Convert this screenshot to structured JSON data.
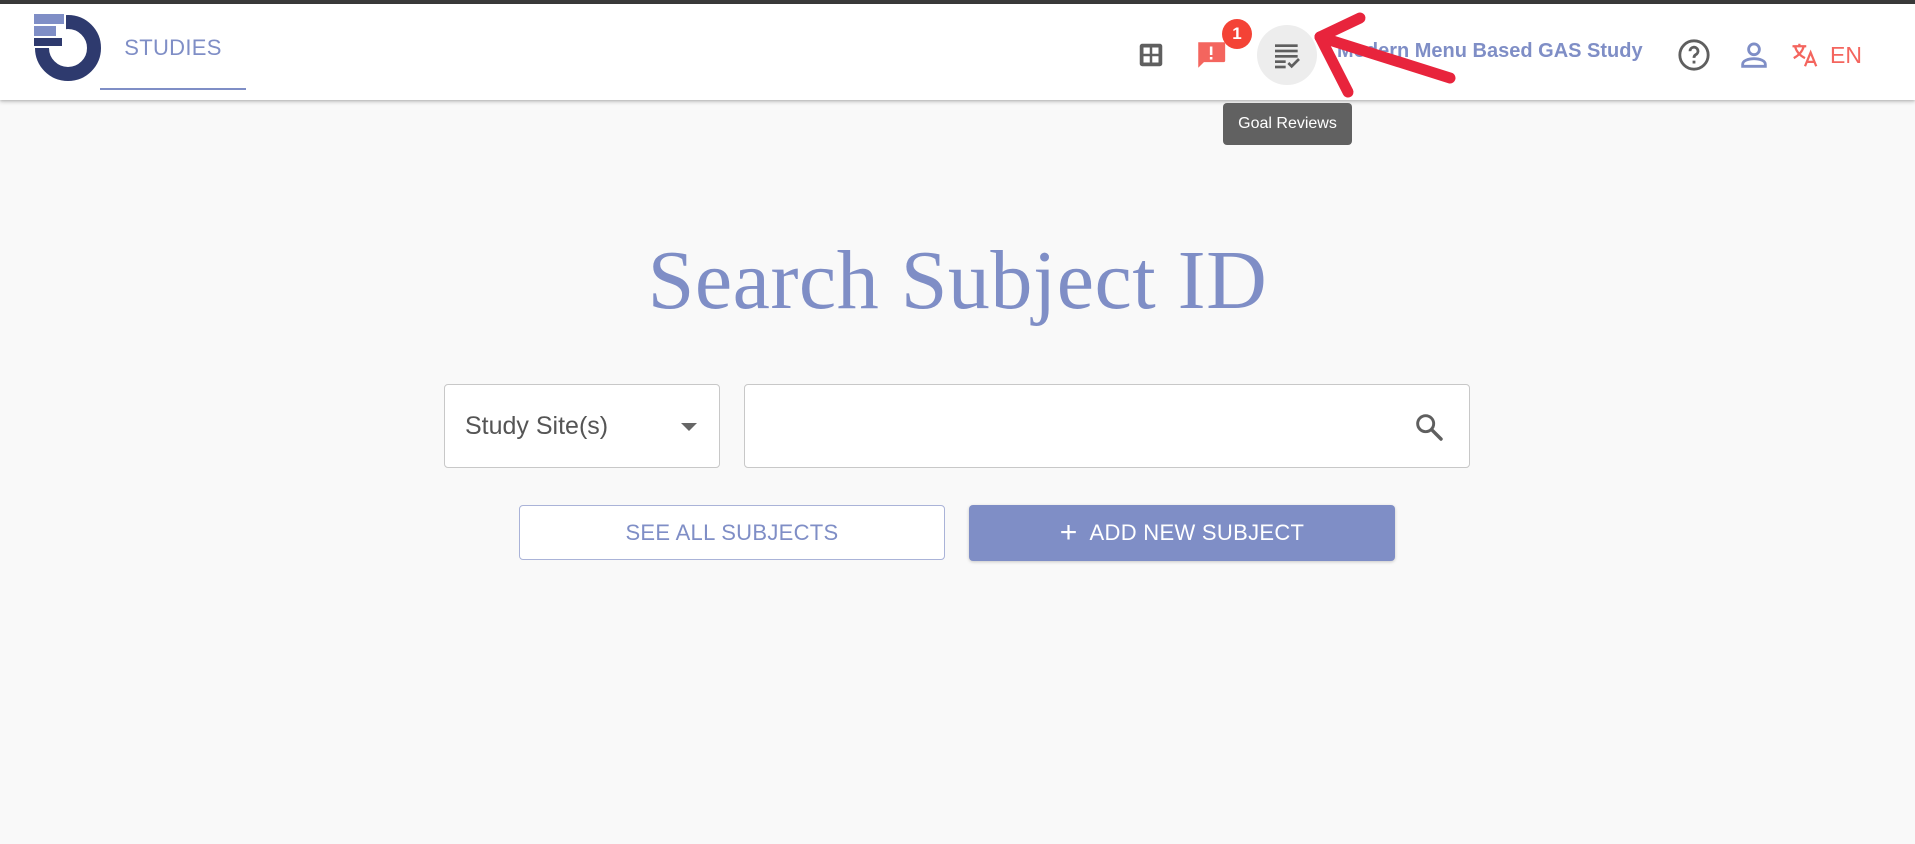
{
  "nav": {
    "tab_studies": "STUDIES"
  },
  "header": {
    "alert_count": "1",
    "study_name": "Modern Menu Based GAS Study",
    "language": "EN",
    "tooltip": "Goal Reviews"
  },
  "main": {
    "title": "Search Subject ID",
    "site_select_label": "Study Site(s)",
    "search_value": "",
    "see_all_label": "SEE ALL SUBJECTS",
    "add_new_label": "ADD NEW SUBJECT"
  },
  "icons": {
    "apps": "apps-grid-icon",
    "alerts": "feedback-alert-icon",
    "goal_reviews": "checklist-icon",
    "help": "help-circle-icon",
    "user": "person-icon",
    "language": "translate-icon",
    "search": "search-icon",
    "add": "plus-icon"
  },
  "colors": {
    "accent": "#7f8ec6",
    "alert": "#f44336",
    "language": "#f4655e",
    "logo_dark": "#2e3a6e",
    "annotation_arrow": "#e8243c"
  }
}
